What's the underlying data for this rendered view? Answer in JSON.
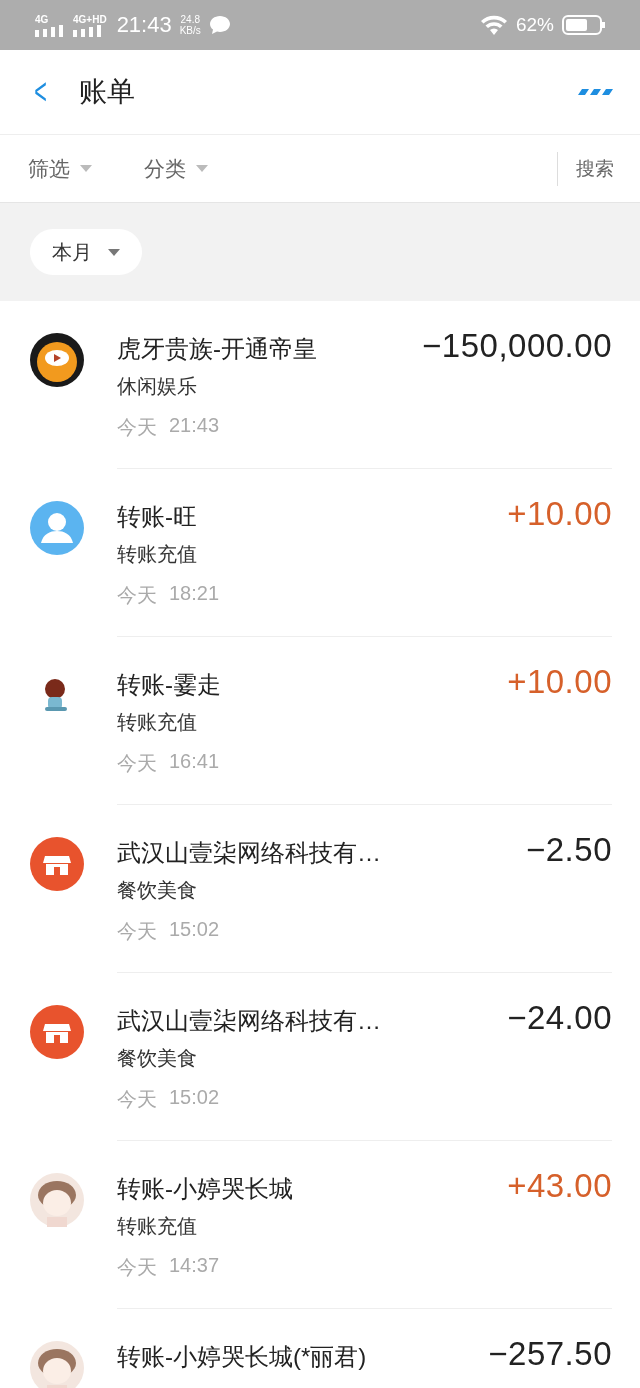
{
  "status_bar": {
    "network_1": "4G",
    "network_2": "4G+HD",
    "time": "21:43",
    "speed_value": "24.8",
    "speed_unit": "KB/s",
    "battery": "62%"
  },
  "header": {
    "back": "<",
    "title": "账单"
  },
  "filters": [
    {
      "label": "筛选"
    },
    {
      "label": "分类"
    }
  ],
  "search": "搜索",
  "period": "本月",
  "transactions": [
    {
      "kind": "app",
      "title": "虎牙贵族-开通帝皇",
      "category": "休闲娱乐",
      "day": "今天",
      "time": "21:43",
      "amount": "−150,000.00",
      "color": "#222222"
    },
    {
      "kind": "default",
      "title": "转账-旺",
      "category": "转账充值",
      "day": "今天",
      "time": "18:21",
      "amount": "+10.00",
      "color": "#d6602a"
    },
    {
      "kind": "figure",
      "title": "转账-霎走",
      "category": "转账充值",
      "day": "今天",
      "time": "16:41",
      "amount": "+10.00",
      "color": "#d6602a"
    },
    {
      "kind": "shop",
      "title": "武汉山壹柒网络科技有…",
      "category": "餐饮美食",
      "day": "今天",
      "time": "15:02",
      "amount": "−2.50",
      "color": "#222222"
    },
    {
      "kind": "shop",
      "title": "武汉山壹柒网络科技有…",
      "category": "餐饮美食",
      "day": "今天",
      "time": "15:02",
      "amount": "−24.00",
      "color": "#222222"
    },
    {
      "kind": "girl",
      "title": "转账-小婷哭长城",
      "category": "转账充值",
      "day": "今天",
      "time": "14:37",
      "amount": "+43.00",
      "color": "#d6602a"
    },
    {
      "kind": "girl",
      "title": "转账-小婷哭长城(*丽君)",
      "amount": "−257.50",
      "color": "#222222"
    }
  ]
}
